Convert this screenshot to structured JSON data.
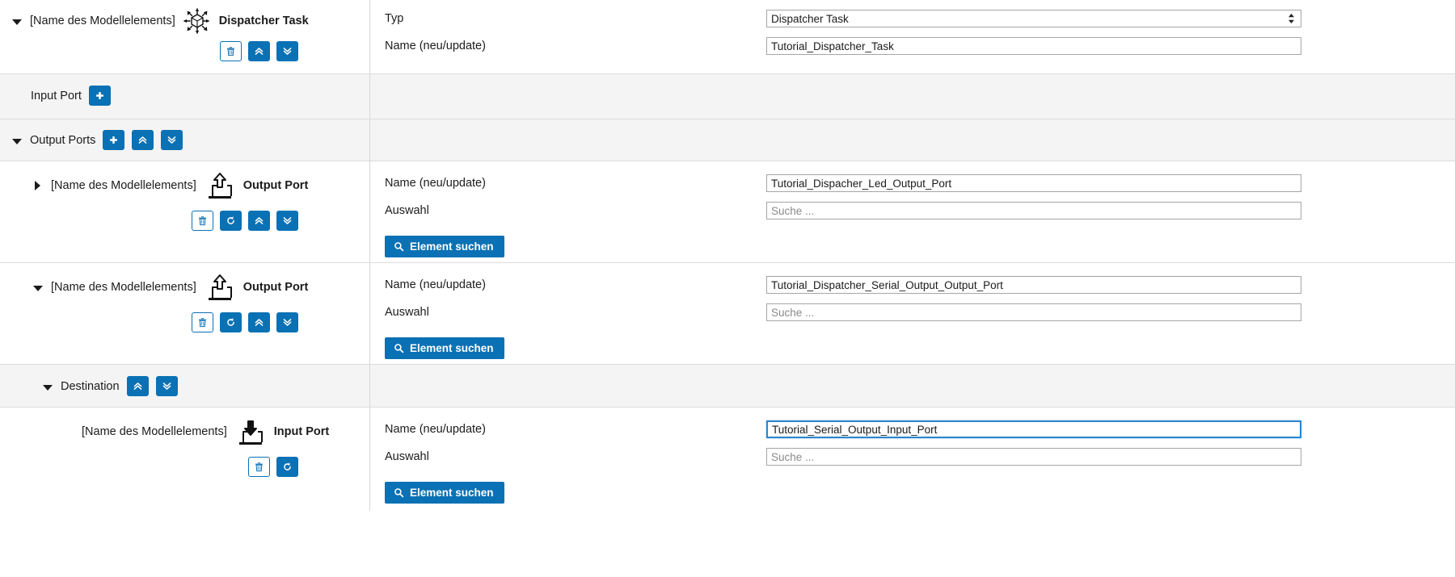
{
  "root": {
    "element_label": "[Name des Modellelements]",
    "type_label": "Dispatcher Task",
    "type_icon": "dispatcher-task-icon",
    "fields": {
      "typ_label": "Typ",
      "typ_value": "Dispatcher Task",
      "name_label": "Name (neu/update)",
      "name_value": "Tutorial_Dispatcher_Task"
    },
    "buttons": {
      "delete": "delete-icon",
      "move_up": "chevron-double-up-icon",
      "move_down": "chevron-double-down-icon"
    }
  },
  "input_port_section": {
    "label": "Input Port",
    "add_button": "plus-icon"
  },
  "output_ports_section": {
    "label": "Output Ports",
    "add_button": "plus-icon",
    "move_up": "chevron-double-up-icon",
    "move_down": "chevron-double-down-icon"
  },
  "common": {
    "name_label": "Name (neu/update)",
    "auswahl_label": "Auswahl",
    "search_placeholder": "Suche ...",
    "search_button_label": "Element suchen",
    "search_button_icon": "magnifier-icon",
    "element_label": "[Name des Modellelements]"
  },
  "output_ports": [
    {
      "element_label": "[Name des Modellelements]",
      "type_label": "Output Port",
      "type_icon": "output-port-icon",
      "expanded": false,
      "name_label": "Name (neu/update)",
      "name_value": "Tutorial_Dispacher_Led_Output_Port",
      "auswahl_label": "Auswahl",
      "auswahl_placeholder": "Suche ...",
      "search_button_label": "Element suchen"
    },
    {
      "element_label": "[Name des Modellelements]",
      "type_label": "Output Port",
      "type_icon": "output-port-icon",
      "expanded": true,
      "name_label": "Name (neu/update)",
      "name_value": "Tutorial_Dispatcher_Serial_Output_Output_Port",
      "auswahl_label": "Auswahl",
      "auswahl_placeholder": "Suche ...",
      "search_button_label": "Element suchen"
    }
  ],
  "destination_section": {
    "label": "Destination",
    "move_up": "chevron-double-up-icon",
    "move_down": "chevron-double-down-icon"
  },
  "destination_port": {
    "element_label": "[Name des Modellelements]",
    "type_label": "Input Port",
    "type_icon": "input-port-icon",
    "name_label": "Name (neu/update)",
    "name_value": "Tutorial_Serial_Output_Input_Port",
    "auswahl_label": "Auswahl",
    "auswahl_placeholder": "Suche ...",
    "search_button_label": "Element suchen",
    "focused": true
  },
  "colors": {
    "accent": "#0a71b4",
    "shaded_row": "#f4f4f4",
    "border": "#dcdcdc",
    "focus_border": "#2a86d0"
  }
}
